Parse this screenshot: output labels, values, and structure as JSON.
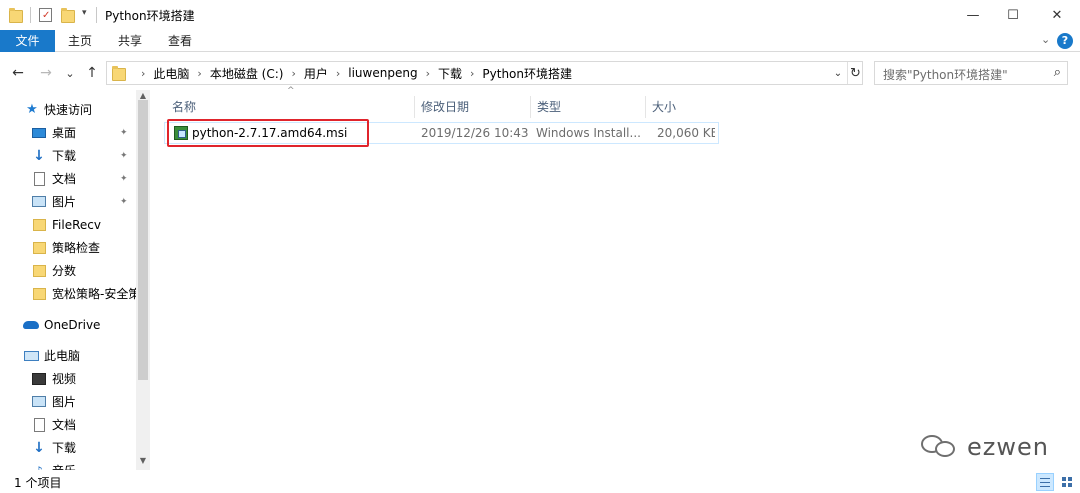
{
  "window": {
    "title": "Python环境搭建",
    "minimize_glyph": "—",
    "maximize_glyph": "☐",
    "close_glyph": "✕"
  },
  "ribbon": {
    "tabs": [
      "文件",
      "主页",
      "共享",
      "查看"
    ],
    "collapse_glyph": "⌄",
    "help_glyph": "?"
  },
  "nav": {
    "back_glyph": "←",
    "forward_glyph": "→",
    "recent_glyph": "⌄",
    "up_glyph": "↑"
  },
  "address": {
    "breadcrumbs": [
      "此电脑",
      "本地磁盘 (C:)",
      "用户",
      "liuwenpeng",
      "下载",
      "Python环境搭建"
    ],
    "separator": "›",
    "dropdown_glyph": "⌄",
    "refresh_glyph": "↻"
  },
  "search": {
    "placeholder": "搜索\"Python环境搭建\"",
    "icon": "search-icon",
    "glyph": "⌕"
  },
  "sidebar": {
    "items": [
      {
        "label": "快速访问",
        "icon": "star-icon",
        "pinned": false
      },
      {
        "label": "桌面",
        "icon": "desktop-icon",
        "pinned": true
      },
      {
        "label": "下载",
        "icon": "download-icon",
        "pinned": true
      },
      {
        "label": "文档",
        "icon": "document-icon",
        "pinned": true
      },
      {
        "label": "图片",
        "icon": "picture-icon",
        "pinned": true
      },
      {
        "label": "FileRecv",
        "icon": "folder-icon",
        "pinned": false
      },
      {
        "label": "策略检查",
        "icon": "folder-icon",
        "pinned": false
      },
      {
        "label": "分数",
        "icon": "folder-icon",
        "pinned": false
      },
      {
        "label": "宽松策略-安全策",
        "icon": "folder-icon",
        "pinned": false
      },
      {
        "label": "OneDrive",
        "icon": "cloud-icon",
        "pinned": false
      },
      {
        "label": "此电脑",
        "icon": "computer-icon",
        "pinned": false
      },
      {
        "label": "视频",
        "icon": "video-icon",
        "pinned": false
      },
      {
        "label": "图片",
        "icon": "picture-icon",
        "pinned": false
      },
      {
        "label": "文档",
        "icon": "document-icon",
        "pinned": false
      },
      {
        "label": "下载",
        "icon": "download-icon",
        "pinned": false
      },
      {
        "label": "音乐",
        "icon": "music-icon",
        "pinned": false
      }
    ],
    "pin_glyph": "📌"
  },
  "file_list": {
    "columns": [
      "名称",
      "修改日期",
      "类型",
      "大小"
    ],
    "sort_glyph": "^",
    "rows": [
      {
        "name": "python-2.7.17.amd64.msi",
        "modified": "2019/12/26 10:43",
        "type": "Windows Install...",
        "size": "20,060 KB",
        "icon": "msi-installer-icon"
      }
    ]
  },
  "status": {
    "count_text": "1 个项目"
  },
  "watermark": {
    "text": "ezwen"
  },
  "colors": {
    "accent": "#1979ca",
    "highlight_border": "#e0242c",
    "row_border": "#cde8ff"
  }
}
